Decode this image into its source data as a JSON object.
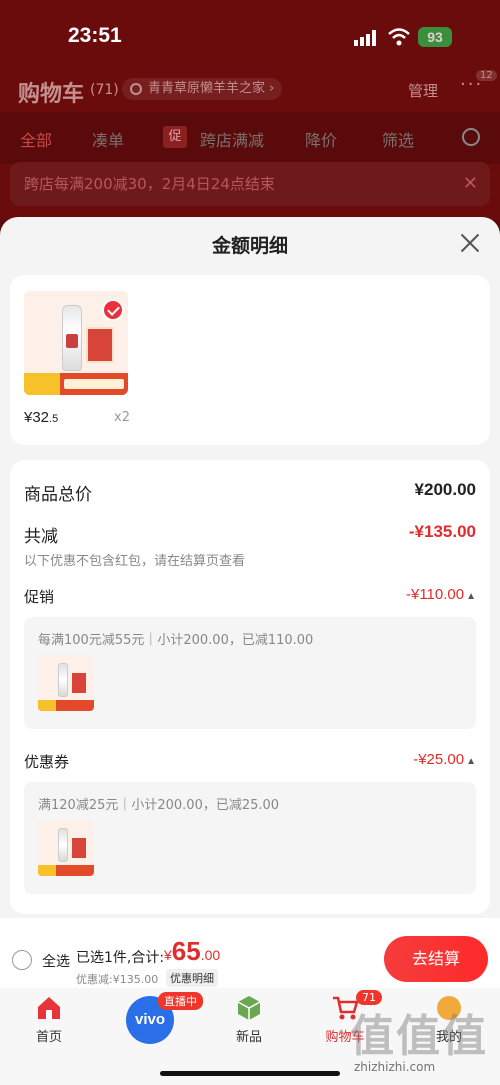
{
  "status": {
    "time": "23:51",
    "battery": "93"
  },
  "header": {
    "title": "购物车",
    "count": "(71)",
    "location": "青青草原懒羊羊之家",
    "manage": "管理",
    "more_badge": "12"
  },
  "tabs": {
    "all": "全部",
    "coudan": "凑单",
    "promo_tag": "促",
    "cross_store": "跨店满减",
    "price_drop": "降价",
    "filter": "筛选"
  },
  "banner": {
    "text": "跨店每满200减30，2月4日24点结束"
  },
  "sheet": {
    "title": "金额明细",
    "product": {
      "price_int": "¥32",
      "price_dec": ".5",
      "qty": "x2"
    },
    "total_label": "商品总价",
    "total_value": "¥200.00",
    "reduce_label": "共减",
    "reduce_value": "-¥135.00",
    "reduce_note": "以下优惠不包含红包，请在结算页查看",
    "promo_label": "促销",
    "promo_value": "-¥110.00",
    "promo_detail": "每满100元减55元｜小计200.00，已减110.00",
    "coupon_label": "优惠券",
    "coupon_value": "-¥25.00",
    "coupon_detail": "满120减25元｜小计200.00，已减25.00"
  },
  "bottom": {
    "select_all": "全选",
    "selected": "已选1件,合计:",
    "total_currency": "¥",
    "total_int": "65",
    "total_dec": ".00",
    "discount": "优惠减:¥135.00",
    "detail_tag": "优惠明细",
    "checkout": "去结算"
  },
  "tabbar": {
    "home": "首页",
    "vivo": "vivo",
    "live": "直播中",
    "new": "新品",
    "cart": "购物车",
    "cart_badge": "71",
    "mine": "我的"
  },
  "watermark": {
    "site": "zhizhizhi.com",
    "logo": "值值值"
  }
}
